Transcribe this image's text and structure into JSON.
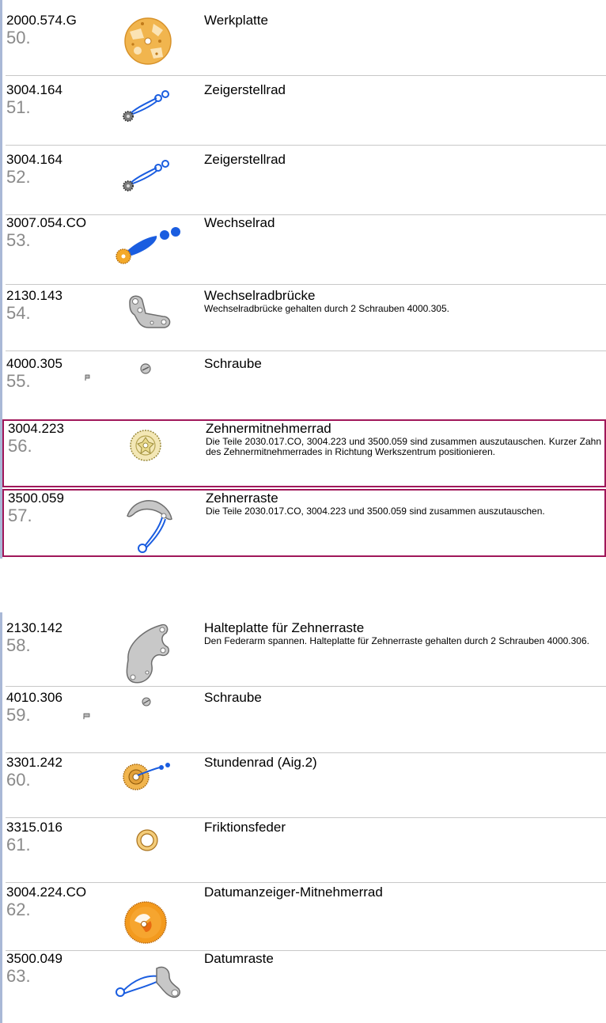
{
  "parts": [
    {
      "ref": "2000.574.G",
      "pos": "50.",
      "title": "Werkplatte",
      "note": "",
      "icon": "mainplate-icon"
    },
    {
      "ref": "3004.164",
      "pos": "51.",
      "title": "Zeigerstellrad",
      "note": "",
      "icon": "setting-wheel-icon"
    },
    {
      "ref": "3004.164",
      "pos": "52.",
      "title": "Zeigerstellrad",
      "note": "",
      "icon": "setting-wheel-icon"
    },
    {
      "ref": "3007.054.CO",
      "pos": "53.",
      "title": "Wechselrad",
      "note": "",
      "icon": "minute-wheel-icon"
    },
    {
      "ref": "2130.143",
      "pos": "54.",
      "title": "Wechselradbrücke",
      "note": "Wechselradbrücke gehalten durch 2 Schrauben 4000.305.",
      "icon": "bridge-icon"
    },
    {
      "ref": "4000.305",
      "pos": "55.",
      "title": "Schraube",
      "note": "",
      "icon": "screw-icon"
    },
    {
      "ref": "3004.223",
      "pos": "56.",
      "title": "Zehnermitnehmerrad",
      "note": "Die Teile 2030.017.CO, 3004.223 und 3500.059 sind zusammen auszutauschen.  Kurzer Zahn des Zehnermitnehmerrades in Richtung Werkszentrum positionieren.",
      "icon": "driving-wheel-icon"
    },
    {
      "ref": "3500.059",
      "pos": "57.",
      "title": "Zehnerraste",
      "note": "Die Teile 2030.017.CO, 3004.223 und 3500.059 sind zusammen auszutauschen.",
      "icon": "jumper-icon"
    },
    {
      "ref": "2130.142",
      "pos": "58.",
      "title": "Halteplatte für Zehnerraste",
      "note": "Den Federarm spannen. Halteplatte für Zehnerraste gehalten durch 2 Schrauben 4000.306.",
      "icon": "holding-plate-icon"
    },
    {
      "ref": "4010.306",
      "pos": "59.",
      "title": "Schraube",
      "note": "",
      "icon": "screw-icon"
    },
    {
      "ref": "3301.242",
      "pos": "60.",
      "title": "Stundenrad (Aig.2)",
      "note": "",
      "icon": "hour-wheel-icon"
    },
    {
      "ref": "3315.016",
      "pos": "61.",
      "title": "Friktionsfeder",
      "note": "",
      "icon": "friction-spring-icon"
    },
    {
      "ref": "3004.224.CO",
      "pos": "62.",
      "title": "Datumanzeiger-Mitnehmerrad",
      "note": "",
      "icon": "date-driving-wheel-icon"
    },
    {
      "ref": "3500.049",
      "pos": "63.",
      "title": "Datumraste",
      "note": "",
      "icon": "date-jumper-icon"
    }
  ]
}
